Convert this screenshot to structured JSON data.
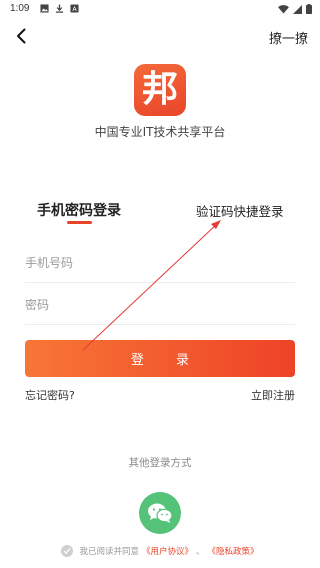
{
  "status_bar": {
    "time": "1:09"
  },
  "header": {
    "scan_label": "撩一撩"
  },
  "brand": {
    "logo_char": "邦",
    "slogan": "中国专业IT技术共享平台"
  },
  "tabs": {
    "password_login": "手机密码登录",
    "sms_login": "验证码快捷登录"
  },
  "form": {
    "phone_placeholder": "手机号码",
    "password_placeholder": "密码",
    "login_label": "登 录"
  },
  "links": {
    "forgot_password": "忘记密码?",
    "register": "立即注册"
  },
  "other_login": {
    "label": "其他登录方式",
    "icon": "wechat-icon"
  },
  "agreement": {
    "prefix": "我已阅读并同意",
    "user_agreement": "《用户协议》",
    "separator": "、",
    "privacy_policy": "《隐私政策》"
  },
  "colors": {
    "accent": "#e9442a",
    "wechat": "#55c27a",
    "annotation": "#e53935"
  }
}
